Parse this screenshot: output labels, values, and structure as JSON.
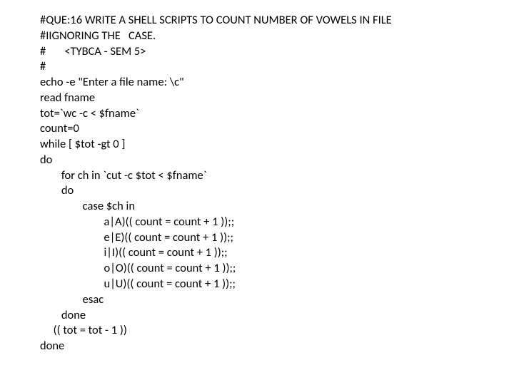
{
  "lines": [
    "#QUE:16 WRITE A SHELL SCRIPTS TO COUNT NUMBER OF VOWELS IN FILE",
    "#IIGNORING THE   CASE.",
    "#       <TYBCA - SEM 5>",
    "#",
    "echo -e \"Enter a file name: \\c\"",
    "read fname",
    "tot=`wc -c < $fname`",
    "count=0",
    "while [ $tot -gt 0 ]",
    "do",
    "        for ch in `cut -c $tot < $fname`",
    "        do",
    "                case $ch in",
    "                        a|A)(( count = count + 1 ));;",
    "                        e|E)(( count = count + 1 ));;",
    "                        i|I)(( count = count + 1 ));;",
    "                        o|O)(( count = count + 1 ));;",
    "                        u|U)(( count = count + 1 ));;",
    "                esac",
    "        done",
    "     (( tot = tot - 1 ))",
    "done"
  ]
}
